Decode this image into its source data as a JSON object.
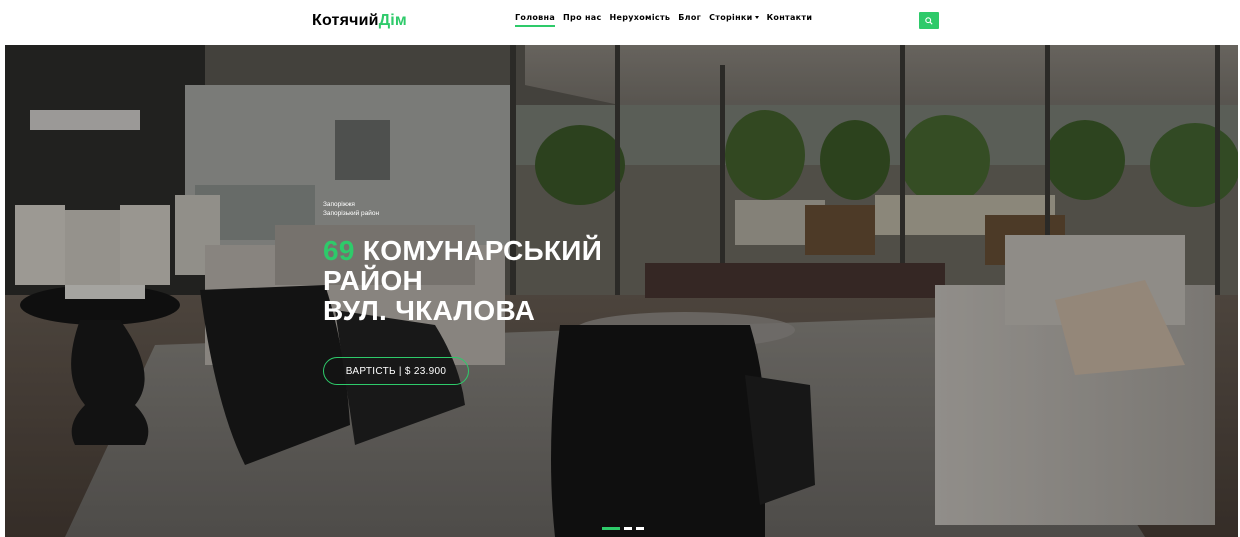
{
  "brand": {
    "name_main": "Котячий",
    "name_accent": "Дім",
    "accent_color": "#2eca6a"
  },
  "nav": {
    "items": [
      {
        "label": "Головна",
        "active": true
      },
      {
        "label": "Про нас"
      },
      {
        "label": "Нерухомість"
      },
      {
        "label": "Блог"
      },
      {
        "label": "Сторінки",
        "dropdown": true
      },
      {
        "label": "Контакти"
      }
    ],
    "search_icon": "search-icon"
  },
  "hero": {
    "location_city": "Запоріжжя",
    "location_district": "Запорізький район",
    "number": "69",
    "title_line1": "КОМУНАРСЬКИЙ",
    "title_line2": "РАЙОН",
    "title_line3": "ВУЛ. ЧКАЛОВА",
    "price_label": "ВАРТІСТЬ | $ 23.900"
  },
  "carousel": {
    "slides": 3,
    "active_index": 0
  }
}
